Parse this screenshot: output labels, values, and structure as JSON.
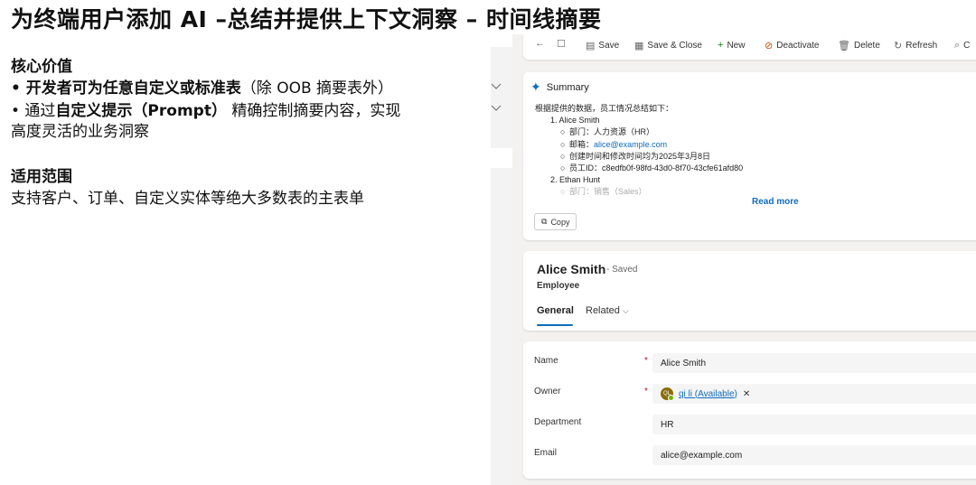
{
  "slide": {
    "title": "为终端用户添加 AI –总结并提供上下文洞察 – 时间线摘要",
    "core_value": {
      "heading": "核心价值",
      "bullet1_bold": "• 开发者可为任意自定义或标准表",
      "bullet1_rest": "（除 OOB 摘要表外）",
      "bullet2_pre": "• 通过",
      "bullet2_bold": "自定义提示（Prompt）",
      "bullet2_rest": " 精确控制摘要内容，实现",
      "bullet2_line2": "高度灵活的业务洞察"
    },
    "scope": {
      "heading": "适用范围",
      "text": "支持客户、订单、自定义实体等绝大多数表的主表单"
    }
  },
  "commandbar": {
    "items": [
      {
        "icon": "back-arrow-icon",
        "label": ""
      },
      {
        "icon": "popout-icon",
        "label": ""
      },
      {
        "icon": "save-icon",
        "label": "Save"
      },
      {
        "icon": "save-close-icon",
        "label": "Save & Close"
      },
      {
        "icon": "plus-icon",
        "label": "New"
      },
      {
        "icon": "deactivate-icon",
        "label": "Deactivate"
      },
      {
        "icon": "delete-icon",
        "label": "Delete"
      },
      {
        "icon": "refresh-icon",
        "label": "Refresh"
      },
      {
        "icon": "search-icon",
        "label": "C"
      }
    ]
  },
  "summary": {
    "title": "Summary",
    "intro": "根据提供的数据，员工情况总结如下：",
    "p1_name": "1. Alice Smith",
    "p1_dept": "部门：人力资源（HR）",
    "p1_email_label": "邮箱：",
    "p1_email": "alice@example.com",
    "p1_created": "创建时间和修改时间均为2025年3月8日",
    "p1_id": "员工ID：c8edfb0f-98fd-43d0-8f70-43cfe61afd80",
    "p2_name": "2. Ethan Hunt",
    "p2_dept": "部门：销售（Sales）",
    "read_more": "Read more",
    "copy": "Copy"
  },
  "record": {
    "name": "Alice Smith",
    "saved": "- Saved",
    "entity": "Employee",
    "tabs": [
      "General",
      "Related"
    ]
  },
  "form": {
    "name_label": "Name",
    "name_value": "Alice Smith",
    "owner_label": "Owner",
    "owner_initials": "QL",
    "owner_value": "qi li (Available)",
    "department_label": "Department",
    "department_value": "HR",
    "email_label": "Email",
    "email_value": "alice@example.com",
    "required_mark": "*"
  }
}
